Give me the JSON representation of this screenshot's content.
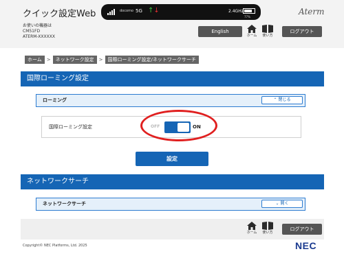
{
  "header": {
    "title": "クイック設定Web",
    "device_label_line1": "お使いの機器は",
    "device_label_line2": "CM51FD",
    "device_label_line3": "ATERM-XXXXXX",
    "brand": "Aterm",
    "status_bar": {
      "carrier": "docomo",
      "network": "5G",
      "band": "2.4GHz",
      "battery_percent": "77%",
      "battery_level": 0.77
    },
    "language_button": "English",
    "home_label": "ホーム",
    "help_label": "使い方",
    "logout_button": "ログアウト"
  },
  "breadcrumb": [
    "ホーム",
    "ネットワーク設定",
    "国際ローミング設定/ネットワークサーチ"
  ],
  "roaming_section": {
    "title": "国際ローミング設定",
    "panel_title": "ローミング",
    "panel_button": "閉じる",
    "setting_label": "国際ローミング設定",
    "toggle_off_label": "OFF",
    "toggle_on_label": "ON",
    "toggle_state": "on",
    "submit_button": "設定"
  },
  "network_search_section": {
    "title": "ネットワークサーチ",
    "panel_title": "ネットワークサーチ",
    "panel_button": "開く"
  },
  "footer": {
    "home_label": "ホーム",
    "help_label": "使い方",
    "logout_button": "ログアウト",
    "copyright": "Copyright© NEC Platforms, Ltd. 2025",
    "logo": "NEC"
  },
  "colors": {
    "primary_blue": "#1565b5",
    "panel_bg": "#e5f0fa",
    "header_bg": "#f3f3f3",
    "dark_button": "#555555",
    "highlight": "#e02020",
    "logo_blue": "#1a3a8f"
  }
}
